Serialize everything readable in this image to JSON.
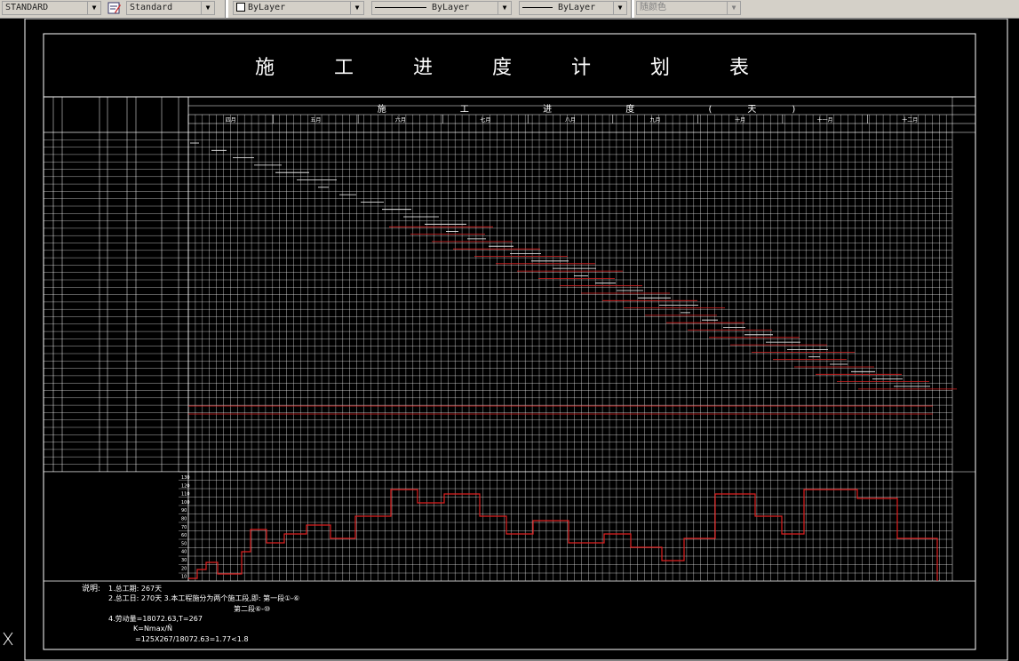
{
  "toolbar": {
    "text_style": "STANDARD",
    "dim_style": "Standard",
    "layer": "ByLayer",
    "linetype": "ByLayer",
    "lineweight": "ByLayer",
    "plot_color": "随颜色"
  },
  "drawing": {
    "title": "施  工  进  度  计  划  表",
    "header_progress": "施  工  进  度  (天)",
    "months": [
      "四月",
      "五月",
      "六月",
      "七月",
      "八月",
      "九月",
      "十月",
      "十一月",
      "十二月"
    ],
    "notes": {
      "label": "说明:",
      "line1": "1.总工期: 267天",
      "line2": "2.总工日: 270天 3.本工程施分为两个施工段,即: 第一段①-⑥",
      "line3": "第二段⑥-⑩",
      "line4": "4.劳动量=18072.63,T=267",
      "line5": "K=Nmax/Ñ",
      "line6": "=125X267/18072.63=1.77<1.8"
    },
    "y_axis": [
      "130",
      "120",
      "110",
      "100",
      "90",
      "80",
      "70",
      "60",
      "50",
      "40",
      "30",
      "20",
      "10"
    ]
  }
}
